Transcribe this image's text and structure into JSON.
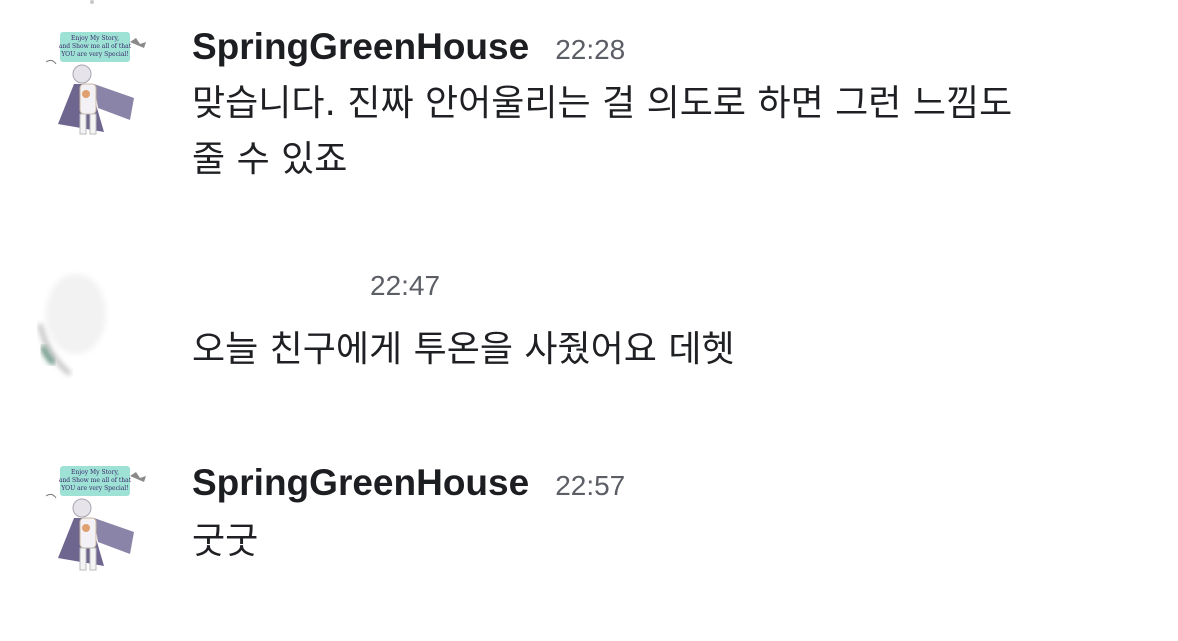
{
  "messages": [
    {
      "username": "SpringGreenHouse",
      "time": "22:28",
      "lines": [
        "맞습니다. 진짜 안어울리는 걸 의도로 하면 그런 느낌도",
        "줄 수 있죠"
      ],
      "avatar_banner": [
        "Enjoy My Story,",
        "and Show me all of that",
        "YOU are very Special!"
      ]
    },
    {
      "username": "",
      "time": "22:47",
      "lines": [
        "오늘 친구에게 투온을 사줬어요 데헷"
      ]
    },
    {
      "username": "SpringGreenHouse",
      "time": "22:57",
      "lines": [
        "굿굿"
      ],
      "avatar_banner": [
        "Enjoy My Story,",
        "and Show me all of that",
        "YOU are very Special!"
      ]
    }
  ],
  "colors": {
    "background": "#ffffff",
    "username": "#1d1e21",
    "timestamp": "#5c5e66",
    "text": "#1f2023",
    "banner": "#9ee2d6"
  }
}
